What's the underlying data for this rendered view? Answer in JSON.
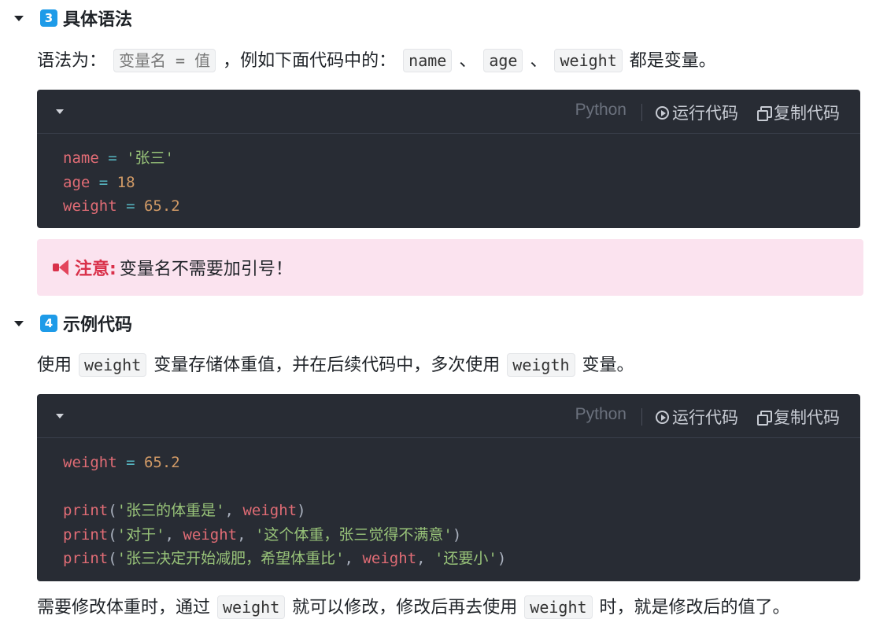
{
  "section3": {
    "number": "3",
    "title": "具体语法",
    "intro": {
      "prefix": "语法为：",
      "syntax": "变量名 = 值",
      "middle": "，例如下面代码中的：",
      "var1": "name",
      "sep1": "、",
      "var2": "age",
      "sep2": "、",
      "var3": "weight",
      "suffix": "都是变量。"
    },
    "code": {
      "language": "Python",
      "run_label": "运行代码",
      "copy_label": "复制代码",
      "lines": [
        {
          "var": "name",
          "op": " = ",
          "str": "'张三'"
        },
        {
          "var": "age",
          "op": " = ",
          "num": "18"
        },
        {
          "var": "weight",
          "op": " = ",
          "num": "65.2"
        }
      ]
    },
    "notice": {
      "label": "注意:",
      "text": "变量名不需要加引号！"
    }
  },
  "section4": {
    "number": "4",
    "title": "示例代码",
    "intro": {
      "prefix": "使用",
      "var1": "weight",
      "middle": "变量存储体重值，并在后续代码中，多次使用",
      "var2": "weigth",
      "suffix": "变量。"
    },
    "code": {
      "language": "Python",
      "run_label": "运行代码",
      "copy_label": "复制代码",
      "line1": {
        "var": "weight",
        "op": " = ",
        "num": "65.2"
      },
      "print1": {
        "fn": "print",
        "open": "(",
        "s1": "'张三的体重是'",
        "c1": ", ",
        "v": "weight",
        "close": ")"
      },
      "print2": {
        "fn": "print",
        "open": "(",
        "s1": "'对于'",
        "c1": ", ",
        "v": "weight",
        "c2": ", ",
        "s2": "'这个体重，张三觉得不满意'",
        "close": ")"
      },
      "print3": {
        "fn": "print",
        "open": "(",
        "s1": "'张三决定开始减肥，希望体重比'",
        "c1": ", ",
        "v": "weight",
        "c2": ", ",
        "s2": "'还要小'",
        "close": ")"
      }
    },
    "outro": {
      "prefix": "需要修改体重时，通过",
      "var1": "weight",
      "middle": "就可以修改，修改后再去使用",
      "var2": "weight",
      "suffix": "时，就是修改后的值了。"
    }
  }
}
